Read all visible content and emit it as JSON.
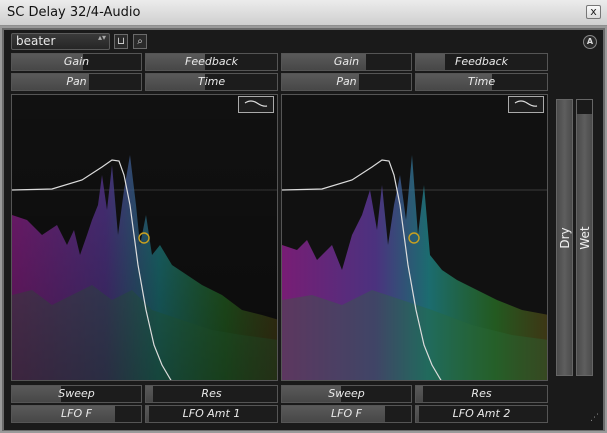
{
  "window": {
    "title": "SC Delay 32/4-Audio",
    "close_label": "x"
  },
  "toolbar": {
    "preset_name": "beater",
    "preset_arrows": "▴▾",
    "save_icon": "save-icon",
    "save_glyph": "⊔",
    "search_icon": "search-icon",
    "search_glyph": "⌕",
    "auto_label": "A"
  },
  "channel1": {
    "gain": {
      "label": "Gain",
      "value": 0.55
    },
    "feedback": {
      "label": "Feedback",
      "value": 0.45
    },
    "pan": {
      "label": "Pan",
      "value": 0.6
    },
    "time": {
      "label": "Time",
      "value": 0.45
    },
    "sweep": {
      "label": "Sweep",
      "value": 0.38
    },
    "res": {
      "label": "Res",
      "value": 0.05
    },
    "lfo_f": {
      "label": "LFO F",
      "value": 0.8
    },
    "lfo_amt": {
      "label": "LFO Amt 1",
      "value": 0.02
    }
  },
  "channel2": {
    "gain": {
      "label": "Gain",
      "value": 0.65
    },
    "feedback": {
      "label": "Feedback",
      "value": 0.22
    },
    "pan": {
      "label": "Pan",
      "value": 0.6
    },
    "time": {
      "label": "Time",
      "value": 0.58
    },
    "sweep": {
      "label": "Sweep",
      "value": 0.46
    },
    "res": {
      "label": "Res",
      "value": 0.05
    },
    "lfo_f": {
      "label": "LFO F",
      "value": 0.8
    },
    "lfo_amt": {
      "label": "LFO Amt 2",
      "value": 0.02
    }
  },
  "mix": {
    "dry": {
      "label": "Dry",
      "value": 1.0
    },
    "wet": {
      "label": "Wet",
      "value": 0.95
    }
  },
  "colors": {
    "curve": "#d8d8d8",
    "marker": "#c8a020",
    "spectrum_magenta": "#b02aa8",
    "spectrum_teal": "#1aa0a0",
    "spectrum_green": "#3aa030"
  }
}
